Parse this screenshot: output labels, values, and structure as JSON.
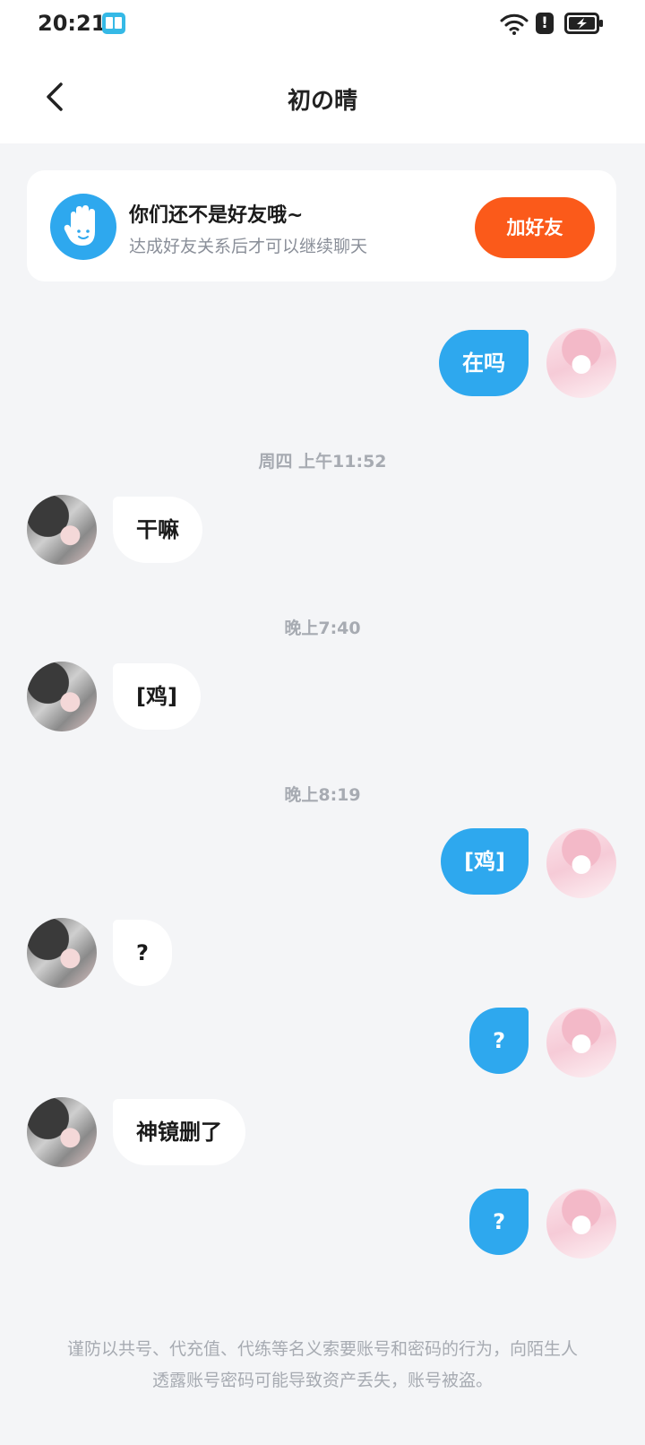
{
  "status_bar": {
    "time": "20:21",
    "icons": [
      "book-icon",
      "wifi-icon",
      "alert-icon",
      "battery-charging-icon"
    ],
    "alert_glyph": "!"
  },
  "header": {
    "title": "初の晴",
    "back_icon": "chevron-left-icon"
  },
  "friend_banner": {
    "icon": "waving-hand-icon",
    "title": "你们还不是好友哦~",
    "subtitle": "达成好友关系后才可以继续聊天",
    "button_label": "加好友",
    "button_color": "#fb5a1a"
  },
  "messages": [
    {
      "type": "out",
      "text": "在吗"
    },
    {
      "type": "time",
      "text": "周四  上午11:52"
    },
    {
      "type": "in",
      "text": "干嘛"
    },
    {
      "type": "time",
      "text": "晚上7:40"
    },
    {
      "type": "in",
      "text": "[鸡]"
    },
    {
      "type": "time",
      "text": "晚上8:19"
    },
    {
      "type": "out",
      "text": "[鸡]"
    },
    {
      "type": "in",
      "text": "?"
    },
    {
      "type": "out",
      "text": "?"
    },
    {
      "type": "in",
      "text": "神镜删了"
    },
    {
      "type": "out",
      "text": "?"
    }
  ],
  "warning": "谨防以共号、代充值、代练等名义索要账号和密码的行为，向陌生人透露账号密码可能导致资产丢失，账号被盗。",
  "colors": {
    "accent_blue": "#2ea8ee",
    "background": "#f4f5f7",
    "muted_text": "#a7abb2"
  }
}
